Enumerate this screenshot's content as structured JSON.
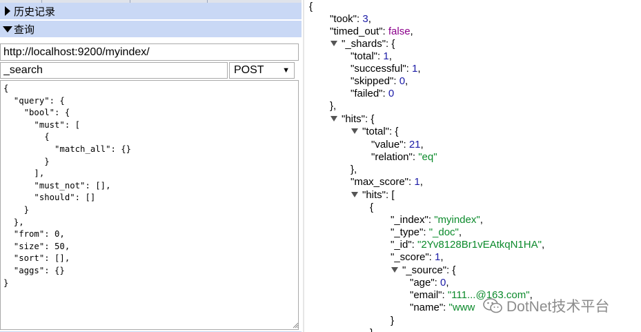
{
  "sidebar": {
    "history_label": "历史记录",
    "query_label": "查询"
  },
  "request": {
    "url": "http://localhost:9200/myindex/",
    "path": "_search",
    "method": "POST",
    "body": "{\n  \"query\": {\n    \"bool\": {\n      \"must\": [\n        {\n          \"match_all\": {}\n        }\n      ],\n      \"must_not\": [],\n      \"should\": []\n    }\n  },\n  \"from\": 0,\n  \"size\": 50,\n  \"sort\": [],\n  \"aggs\": {}\n}"
  },
  "response": {
    "l01": "{",
    "took_key": "\"took\": ",
    "took_val": "3",
    "timed_out_key": "\"timed_out\": ",
    "timed_out_val": "false",
    "shards_key": "\"_shards\": {",
    "total_key": "\"total\": ",
    "total_val": "1",
    "successful_key": "\"successful\": ",
    "successful_val": "1",
    "skipped_key": "\"skipped\": ",
    "skipped_val": "0",
    "failed_key": "\"failed\": ",
    "failed_val": "0",
    "close_brace_comma": "},",
    "hits_key": "\"hits\": {",
    "hits_total_key": "\"total\": {",
    "value_key": "\"value\": ",
    "value_val": "21",
    "relation_key": "\"relation\": ",
    "relation_val": "\"eq\"",
    "close_total": "},",
    "max_score_key": "\"max_score\": ",
    "max_score_val": "1",
    "hits_arr_key": "\"hits\": [",
    "open_obj": "{",
    "index_key": "\"_index\": ",
    "index_val": "\"myindex\"",
    "type_key": "\"_type\": ",
    "type_val": "\"_doc\"",
    "id_key": "\"_id\": ",
    "id_val": "\"2Yv8128Br1vEAtkqN1HA\"",
    "score_key": "\"_score\": ",
    "score_val": "1",
    "source_key": "\"_source\": {",
    "age_key": "\"age\": ",
    "age_val": "0",
    "email_key": "\"email\": ",
    "email_val": "\"111...@163.com\"",
    "name_key": "\"name\": ",
    "name_val": "\"www",
    "close_source": "}",
    "close_hit": "}"
  },
  "watermark": "DotNet技术平台",
  "icons": {
    "collapsed": "triangle-right-icon",
    "expanded": "triangle-down-icon"
  },
  "colors": {
    "accordion_bg": "#c9d8f5",
    "number": "#1a1aa6",
    "string": "#0b8a2b",
    "boolean": "#8b008b"
  }
}
